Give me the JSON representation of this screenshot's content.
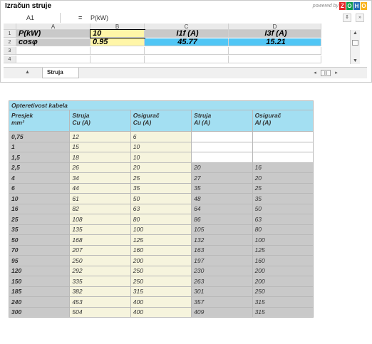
{
  "sheet": {
    "title": "Izračun struje",
    "powered_by": "powered by",
    "logo_letters": [
      "Z",
      "O",
      "H",
      "O"
    ],
    "logo_colors": [
      "#e42527",
      "#089949",
      "#226db4",
      "#f9b21d"
    ],
    "cell_ref": "A1",
    "formula_eq": "=",
    "formula_value": "P(kW)",
    "columns": [
      "A",
      "B",
      "C",
      "D"
    ],
    "rows": [
      {
        "num": "1",
        "cells": [
          "P(kW)",
          "10",
          "I1f (A)",
          "I3f (A)"
        ]
      },
      {
        "num": "2",
        "cells": [
          "cosφ",
          "0.95",
          "45.77",
          "15.21"
        ]
      },
      {
        "num": "3",
        "cells": [
          "",
          "",
          "",
          ""
        ]
      },
      {
        "num": "4",
        "cells": [
          "",
          "",
          "",
          ""
        ]
      }
    ],
    "tab_label": "Struja",
    "colors": {
      "header_grey": "#c9c9c9",
      "input_yellow": "#fff6a8",
      "result_blue": "#51c6f5"
    }
  },
  "cable_table": {
    "caption": "Opteretivost kabela",
    "headers": [
      [
        "Presjek",
        "mm²"
      ],
      [
        "Struja",
        "Cu (A)"
      ],
      [
        "Osigurač",
        "Cu (A)"
      ],
      [
        "Struja",
        "Al (A)"
      ],
      [
        "Osigurač",
        "Al (A)"
      ]
    ],
    "rows": [
      [
        "0,75",
        "12",
        "6",
        "",
        ""
      ],
      [
        "1",
        "15",
        "10",
        "",
        ""
      ],
      [
        "1,5",
        "18",
        "10",
        "",
        ""
      ],
      [
        "2,5",
        "26",
        "20",
        "20",
        "16"
      ],
      [
        "4",
        "34",
        "25",
        "27",
        "20"
      ],
      [
        "6",
        "44",
        "35",
        "35",
        "25"
      ],
      [
        "10",
        "61",
        "50",
        "48",
        "35"
      ],
      [
        "16",
        "82",
        "63",
        "64",
        "50"
      ],
      [
        "25",
        "108",
        "80",
        "86",
        "63"
      ],
      [
        "35",
        "135",
        "100",
        "105",
        "80"
      ],
      [
        "50",
        "168",
        "125",
        "132",
        "100"
      ],
      [
        "70",
        "207",
        "160",
        "163",
        "125"
      ],
      [
        "95",
        "250",
        "200",
        "197",
        "160"
      ],
      [
        "120",
        "292",
        "250",
        "230",
        "200"
      ],
      [
        "150",
        "335",
        "250",
        "263",
        "200"
      ],
      [
        "185",
        "382",
        "315",
        "301",
        "250"
      ],
      [
        "240",
        "453",
        "400",
        "357",
        "315"
      ],
      [
        "300",
        "504",
        "400",
        "409",
        "315"
      ]
    ],
    "colors": {
      "header_blue": "#a3dff2",
      "cu_cream": "#f6f4dd",
      "grey": "#c9c9c9"
    }
  }
}
